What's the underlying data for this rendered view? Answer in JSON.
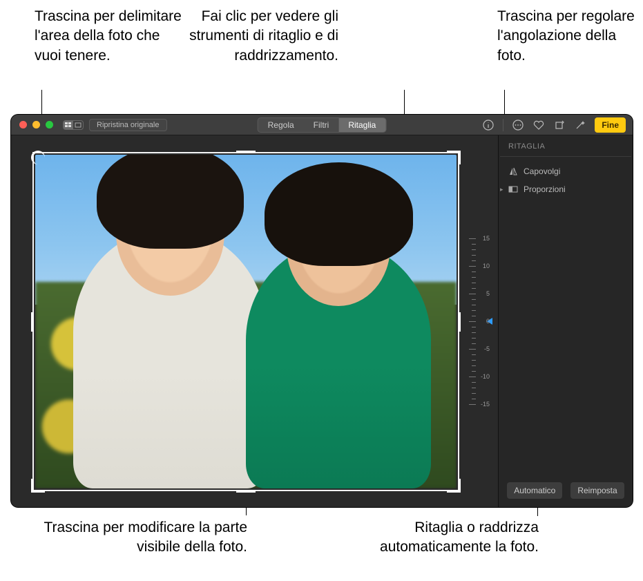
{
  "callouts": {
    "crop_area": "Trascina per delimitare l'area della foto che vuoi tenere.",
    "crop_tools": "Fai clic per vedere gli strumenti di ritaglio e di raddrizzamento.",
    "angle": "Trascina per regolare l'angolazione della foto.",
    "pan": "Trascina per modificare la parte visibile della foto.",
    "auto": "Ritaglia o raddrizza automaticamente la foto."
  },
  "toolbar": {
    "restore": "Ripristina originale",
    "tabs": {
      "adjust": "Regola",
      "filters": "Filtri",
      "crop": "Ritaglia"
    },
    "done": "Fine"
  },
  "sidebar": {
    "title": "RITAGLIA",
    "flip": "Capovolgi",
    "aspect": "Proporzioni",
    "auto": "Automatico",
    "reset": "Reimposta"
  },
  "dial": {
    "labels": [
      "15",
      "10",
      "5",
      "0",
      "-5",
      "-10",
      "-15"
    ],
    "value": 0
  },
  "colors": {
    "accent": "#ffca10",
    "pointer": "#2e9dff"
  }
}
